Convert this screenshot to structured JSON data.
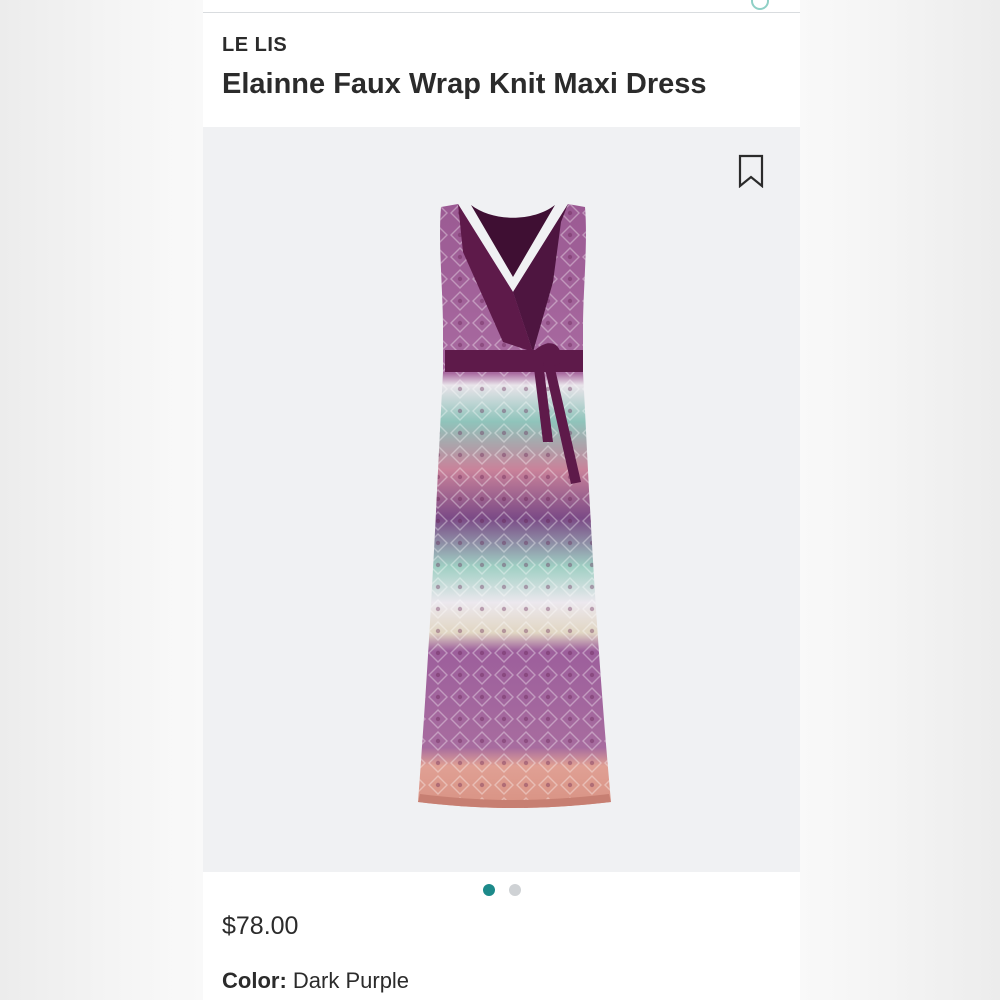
{
  "product": {
    "brand": "LE LIS",
    "title": "Elainne Faux Wrap Knit Maxi Dress",
    "price": "$78.00",
    "color_label": "Color:",
    "color_value": "Dark Purple"
  },
  "gallery": {
    "image_count": 2,
    "active_index": 0,
    "bookmark_icon": "bookmark-icon"
  },
  "colors": {
    "accent": "#1d8a8a",
    "dress_primary": "#5e1a4a",
    "image_background": "#f0f1f3"
  }
}
